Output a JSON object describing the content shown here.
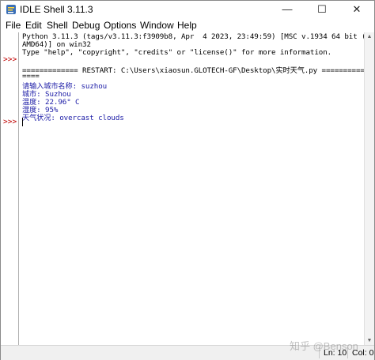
{
  "window": {
    "title": "IDLE Shell 3.11.3",
    "controls": {
      "minimize": "—",
      "maximize": "☐",
      "close": "✕"
    }
  },
  "menubar": {
    "items": [
      "File",
      "Edit",
      "Shell",
      "Debug",
      "Options",
      "Window",
      "Help"
    ]
  },
  "shell": {
    "prompt": ">>>",
    "lines": [
      "Python 3.11.3 (tags/v3.11.3:f3909b8, Apr  4 2023, 23:49:59) [MSC v.1934 64 bit (",
      "AMD64)] on win32",
      "Type \"help\", \"copyright\", \"credits\" or \"license()\" for more information.",
      "============= RESTART: C:\\Users\\xiaosun.GLOTECH-GF\\Desktop\\实时天气.py ==========",
      "====",
      "请输入城市名称: suzhou",
      "城市: Suzhou",
      "温度: 22.96° C",
      "湿度: 95%",
      "天气状况: overcast clouds"
    ]
  },
  "statusbar": {
    "ln": "Ln: 10",
    "col": "Col: 0"
  },
  "watermark": "知乎 @Benson",
  "colors": {
    "prompt": "#c00000",
    "stdout": "#1a1aa6",
    "text": "#000000"
  },
  "icons": {
    "app": "idle-python-icon"
  }
}
